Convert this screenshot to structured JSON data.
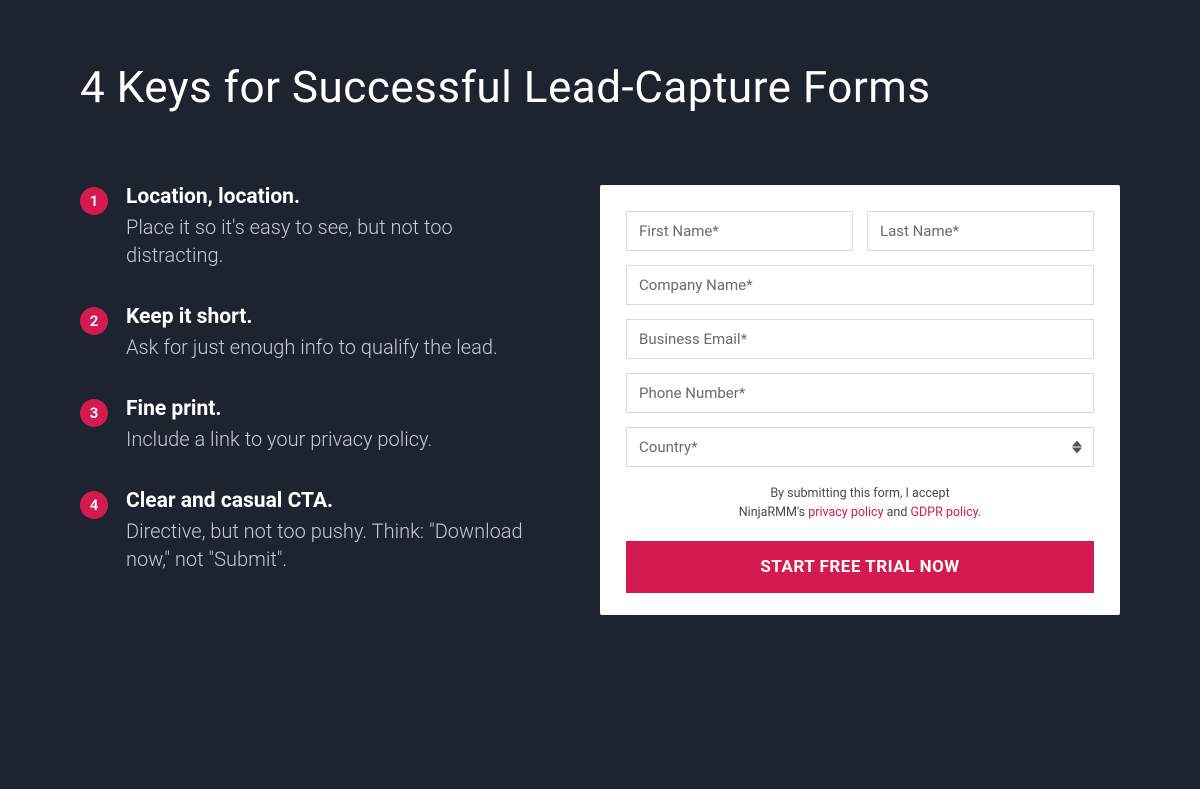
{
  "title": "4 Keys for Successful Lead-Capture Forms",
  "keys": [
    {
      "num": "1",
      "title": "Location, location.",
      "desc": "Place it so it's easy to see, but not too distracting."
    },
    {
      "num": "2",
      "title": "Keep it short.",
      "desc": "Ask for just enough info to qualify the lead."
    },
    {
      "num": "3",
      "title": "Fine print.",
      "desc": "Include a link to your privacy policy."
    },
    {
      "num": "4",
      "title": "Clear and casual CTA.",
      "desc": "Directive, but not too pushy. Think: \"Download now,\" not \"Submit\"."
    }
  ],
  "form": {
    "first_name": "First Name*",
    "last_name": "Last Name*",
    "company": "Company Name*",
    "email": "Business Email*",
    "phone": "Phone Number*",
    "country": "Country*",
    "disclaimer_prefix": "By submitting this form, I accept",
    "disclaimer_brand": "NinjaRMM's ",
    "privacy_link": "privacy policy",
    "disclaimer_and": " and ",
    "gdpr_link": "GDPR policy",
    "disclaimer_end": ".",
    "cta": "START FREE TRIAL NOW"
  }
}
